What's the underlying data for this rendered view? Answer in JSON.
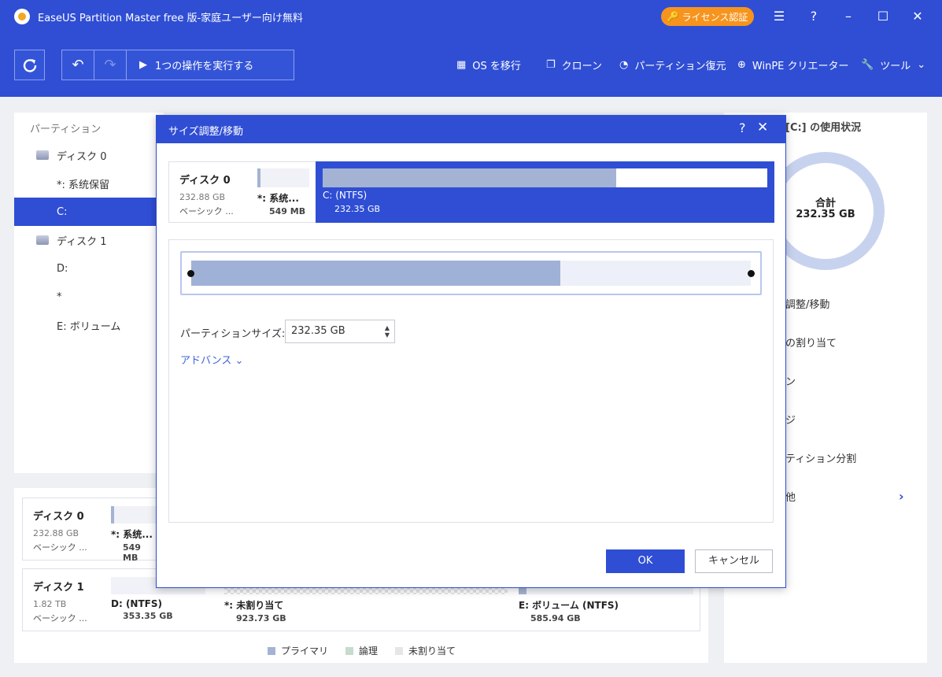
{
  "titlebar": {
    "title": "EaseUS Partition Master free 版-家庭ユーザー向け無料",
    "license_button": "ライセンス認証"
  },
  "toolbar": {
    "run_label": "1つの操作を実行する",
    "items": [
      {
        "label": "OS を移行",
        "icon": "windows-icon"
      },
      {
        "label": "クローン",
        "icon": "clone-icon"
      },
      {
        "label": "パーティション復元",
        "icon": "pie-icon"
      },
      {
        "label": "WinPE クリエーター",
        "icon": "plus-circle-icon"
      },
      {
        "label": "ツール",
        "icon": "wrench-icon"
      }
    ]
  },
  "sidebar": {
    "header": "パーティション",
    "items": [
      {
        "label": "ディスク 0",
        "type": "disk"
      },
      {
        "label": "*: 系统保留",
        "type": "partition"
      },
      {
        "label": "C:",
        "type": "partition",
        "selected": true
      },
      {
        "label": "ディスク 1",
        "type": "disk"
      },
      {
        "label": "D:",
        "type": "partition"
      },
      {
        "label": "*",
        "type": "partition"
      },
      {
        "label": "E: ボリューム",
        "type": "partition"
      }
    ]
  },
  "disk_map": {
    "disk0": {
      "name": "ディスク 0",
      "size": "232.88 GB",
      "type": "ベーシック ...",
      "sys_label": "*: 系统...",
      "sys_size": "549 MB"
    },
    "disk1": {
      "name": "ディスク 1",
      "size": "1.82 TB",
      "type": "ベーシック ...",
      "partitions": [
        {
          "label": "D: (NTFS)",
          "size": "353.35 GB"
        },
        {
          "label": "*: 未割り当て",
          "size": "923.73 GB"
        },
        {
          "label": "E: ボリューム (NTFS)",
          "size": "585.94 GB"
        }
      ]
    },
    "legend": [
      "プライマリ",
      "論理",
      "未割り当て"
    ]
  },
  "right_panel": {
    "usage_title": "[C:] の使用状況",
    "donut_label": "合計",
    "donut_value": "232.35 GB",
    "actions": [
      "調整/移動",
      "の割り当て",
      "ン",
      "ジ",
      "ティション分割",
      "他"
    ]
  },
  "dialog": {
    "title": "サイズ調整/移動",
    "disk_name": "ディスク 0",
    "disk_size": "232.88 GB",
    "disk_type": "ベーシック ...",
    "sys_label": "*: 系统...",
    "sys_size": "549 MB",
    "c_label": "C: (NTFS)",
    "c_size": "232.35 GB",
    "c_used_fraction": 0.66,
    "slider_used_fraction": 0.66,
    "partition_size_label": "パーティションサイズ:",
    "partition_size_value": "232.35 GB",
    "advanced_label": "アドバンス",
    "ok_label": "OK",
    "cancel_label": "キャンセル"
  }
}
